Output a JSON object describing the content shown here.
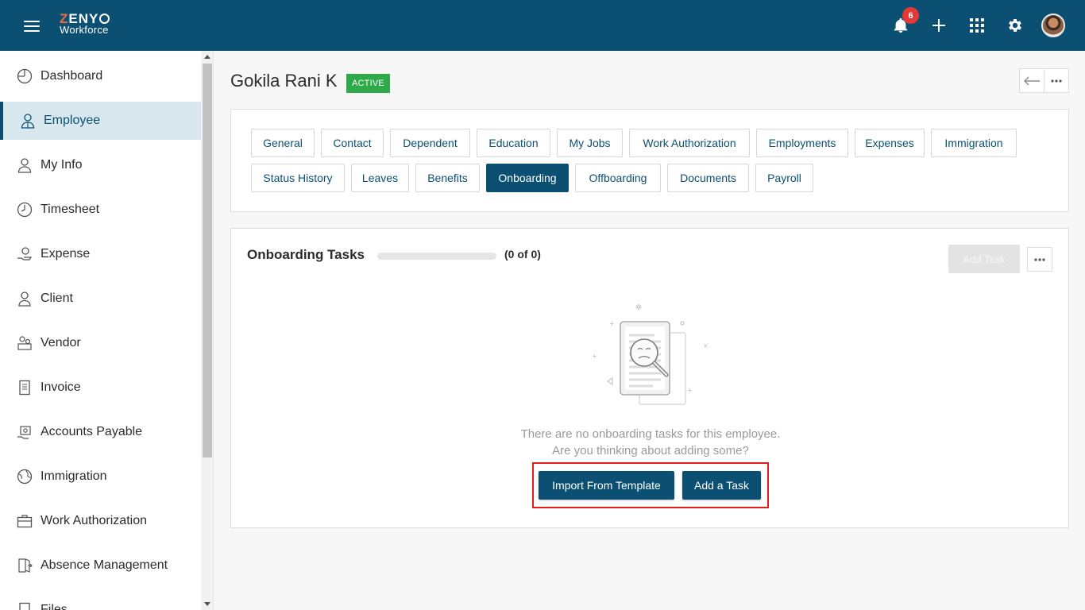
{
  "app": {
    "logo_line1": "ZENY",
    "logo_line2": "Workforce",
    "notification_count": "6"
  },
  "sidebar": {
    "items": [
      {
        "label": "Dashboard",
        "icon": "dashboard-icon"
      },
      {
        "label": "Employee",
        "icon": "employee-icon",
        "active": true
      },
      {
        "label": "My Info",
        "icon": "my-info-icon"
      },
      {
        "label": "Timesheet",
        "icon": "timesheet-icon"
      },
      {
        "label": "Expense",
        "icon": "expense-icon"
      },
      {
        "label": "Client",
        "icon": "client-icon"
      },
      {
        "label": "Vendor",
        "icon": "vendor-icon"
      },
      {
        "label": "Invoice",
        "icon": "invoice-icon"
      },
      {
        "label": "Accounts Payable",
        "icon": "accounts-payable-icon"
      },
      {
        "label": "Immigration",
        "icon": "immigration-icon"
      },
      {
        "label": "Work Authorization",
        "icon": "work-authorization-icon"
      },
      {
        "label": "Absence Management",
        "icon": "absence-management-icon"
      },
      {
        "label": "Files",
        "icon": "files-icon"
      }
    ]
  },
  "employee": {
    "name": "Gokila Rani K",
    "status": "ACTIVE"
  },
  "tabs": [
    {
      "label": "General"
    },
    {
      "label": "Contact"
    },
    {
      "label": "Dependent"
    },
    {
      "label": "Education"
    },
    {
      "label": "My Jobs"
    },
    {
      "label": "Work Authorization"
    },
    {
      "label": "Employments"
    },
    {
      "label": "Expenses"
    },
    {
      "label": "Immigration"
    },
    {
      "label": "Status History"
    },
    {
      "label": "Leaves"
    },
    {
      "label": "Benefits"
    },
    {
      "label": "Onboarding",
      "active": true
    },
    {
      "label": "Offboarding"
    },
    {
      "label": "Documents"
    },
    {
      "label": "Payroll"
    }
  ],
  "onboarding": {
    "title": "Onboarding Tasks",
    "progress_fraction": 0,
    "count": "(0 of 0)",
    "add_task_top": "Add Task",
    "empty_line1": "There are no onboarding tasks for this employee.",
    "empty_line2": "Are you thinking about adding some?",
    "import_button": "Import From Template",
    "add_button": "Add a Task"
  },
  "colors": {
    "brand": "#0b5072",
    "active_badge": "#2eaa4a",
    "notification": "#e53935",
    "highlight": "#e31b1b"
  }
}
